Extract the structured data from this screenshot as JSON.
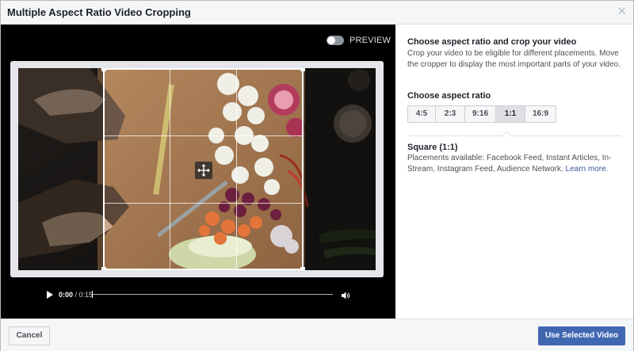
{
  "dialog": {
    "title": "Multiple Aspect Ratio Video Cropping",
    "close_icon": "close-icon"
  },
  "player": {
    "preview_label": "PREVIEW",
    "preview_enabled": false,
    "time_current": "0:00",
    "time_separator": " / ",
    "time_duration": "0:15",
    "progress": 0
  },
  "side": {
    "heading": "Choose aspect ratio and crop your video",
    "description": "Crop your video to be eligible for different placements. Move the cropper to display the most important parts of your video.",
    "ratio_heading": "Choose aspect ratio",
    "ratios": [
      {
        "label": "4:5",
        "selected": false
      },
      {
        "label": "2:3",
        "selected": false
      },
      {
        "label": "9:16",
        "selected": false
      },
      {
        "label": "1:1",
        "selected": true
      },
      {
        "label": "16:9",
        "selected": false
      }
    ],
    "selected_title": "Square (1:1)",
    "placements_text": "Placements available: Facebook Feed, Instant Articles, In-Stream, Instagram Feed, Audience Network.",
    "learn_more": "Learn more."
  },
  "footer": {
    "cancel_label": "Cancel",
    "use_label": "Use Selected Video"
  },
  "colors": {
    "primary": "#4267b2",
    "link": "#385898",
    "video_background": "#000000"
  }
}
